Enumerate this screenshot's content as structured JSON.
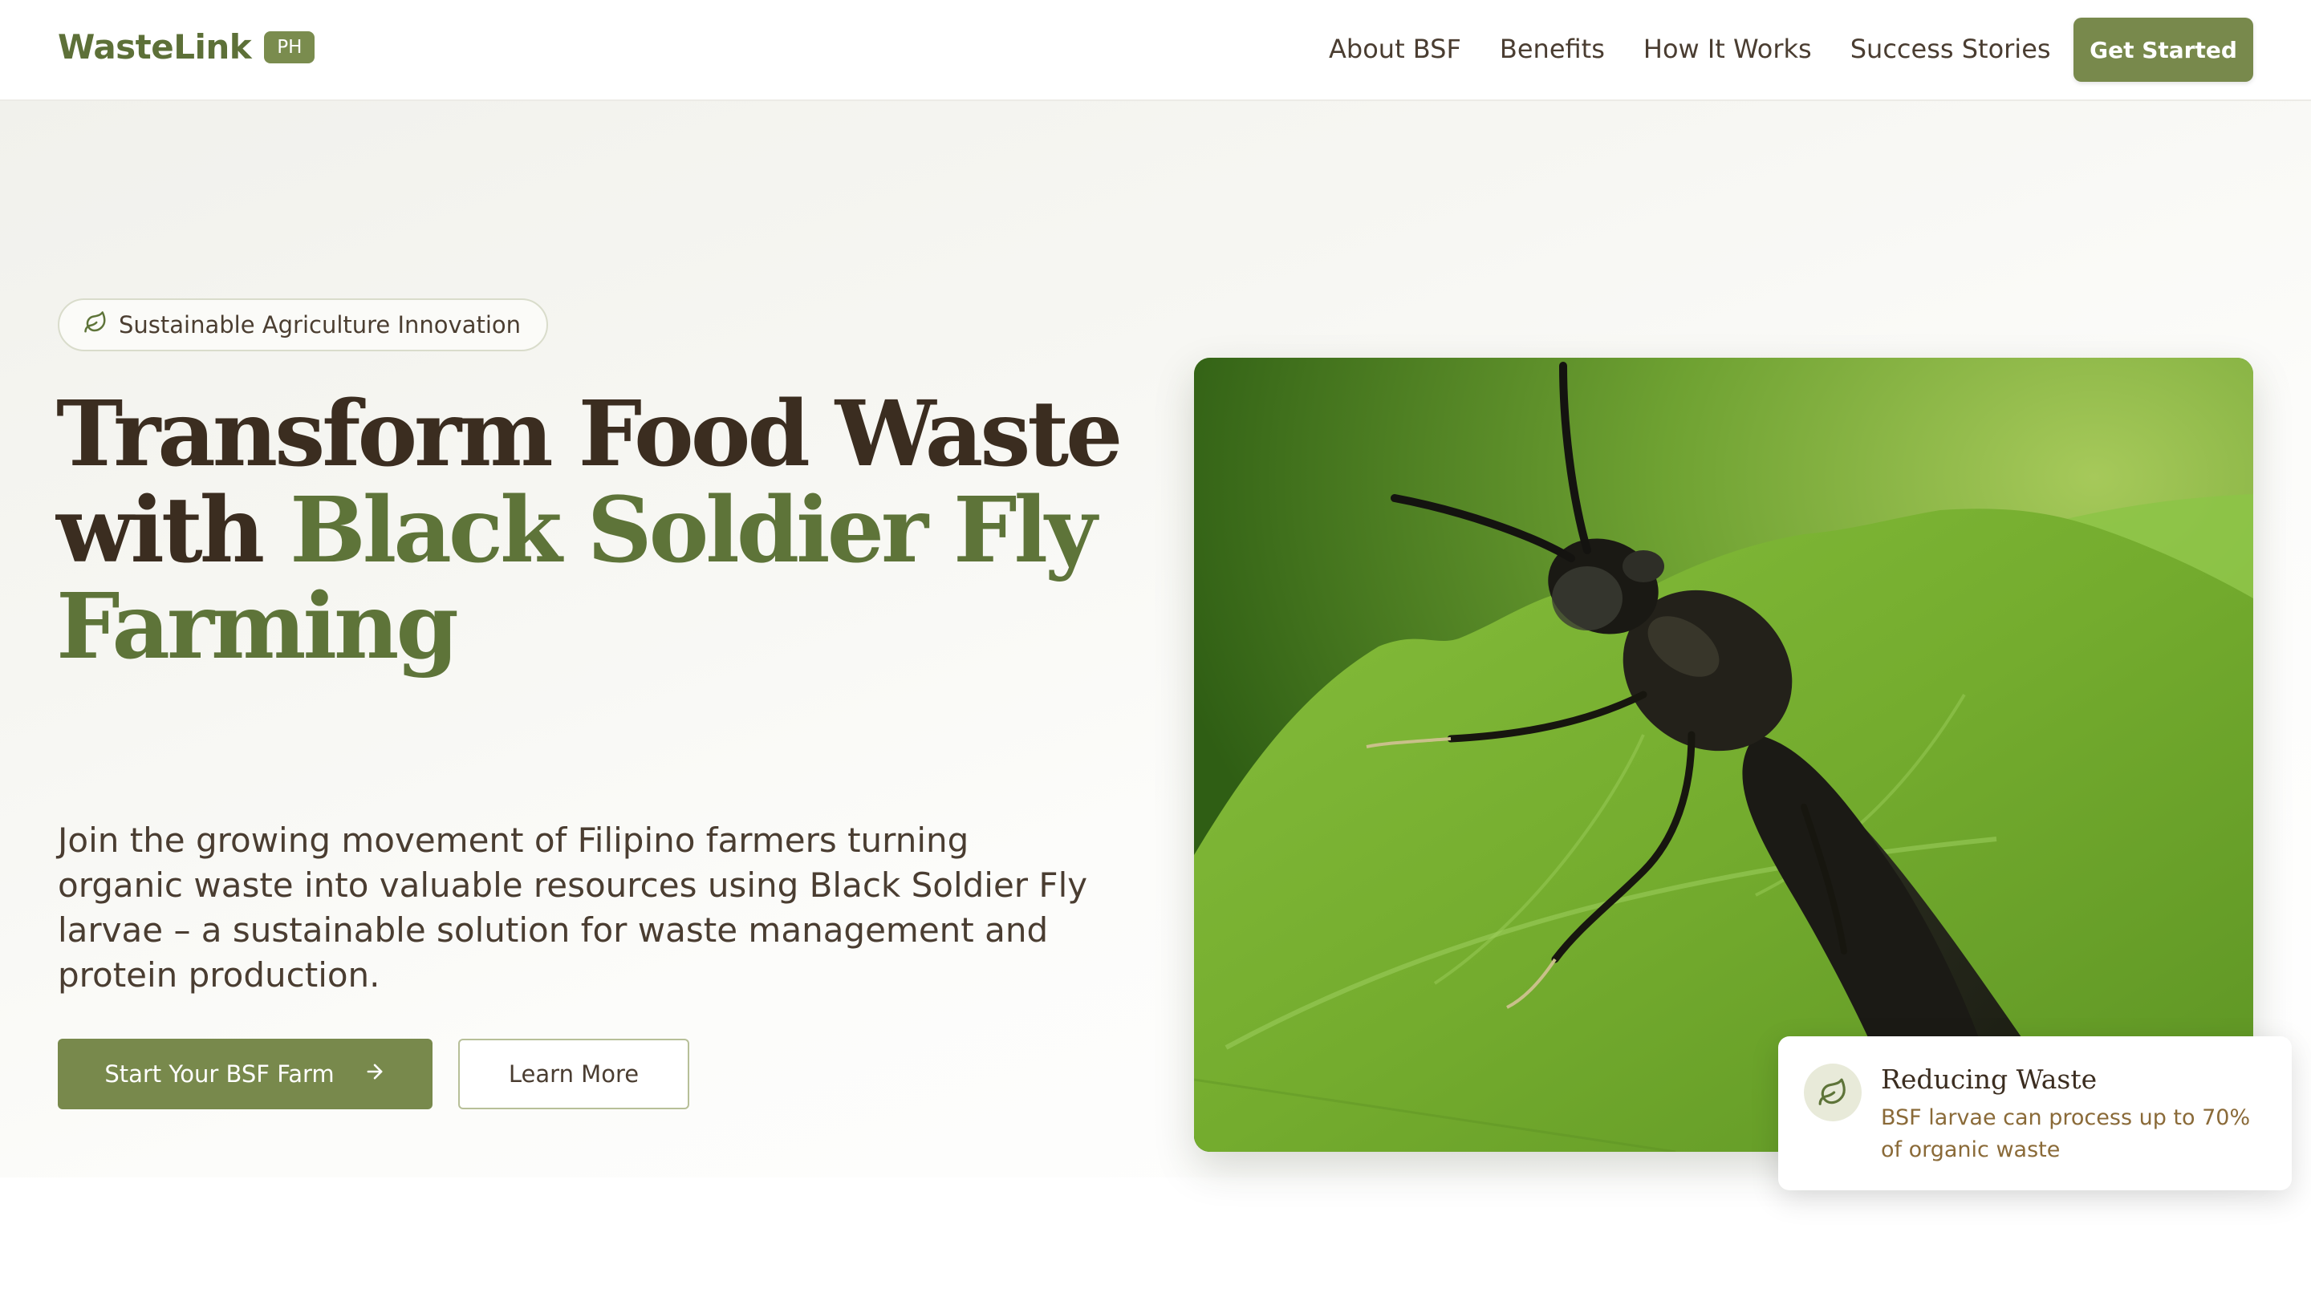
{
  "nav": {
    "brand_name": "WasteLink",
    "brand_badge": "PH",
    "links": [
      "About BSF",
      "Benefits",
      "How It Works",
      "Success Stories"
    ],
    "cta_label": "Get Started"
  },
  "hero": {
    "pill_icon": "leaf-icon",
    "pill_label": "Sustainable Agriculture Innovation",
    "headline_part1": "Transform Food Waste with ",
    "headline_accent": "Black Soldier Fly Farming",
    "lead": "Join the growing movement of Filipino farmers turning organic waste into valuable resources using Black Soldier Fly larvae – a sustainable solution for waste management and protein production.",
    "primary_button": "Start Your BSF Farm",
    "primary_button_icon": "arrow-right-icon",
    "secondary_button": "Learn More"
  },
  "info_card": {
    "icon": "leaf-icon",
    "title": "Reducing Waste",
    "text": "BSF larvae can process up to 70% of organic waste"
  },
  "colors": {
    "brand_green": "#78894c",
    "headline_dark": "#3b2d20",
    "headline_accent": "#5e7439",
    "info_text": "#8a6a38"
  }
}
